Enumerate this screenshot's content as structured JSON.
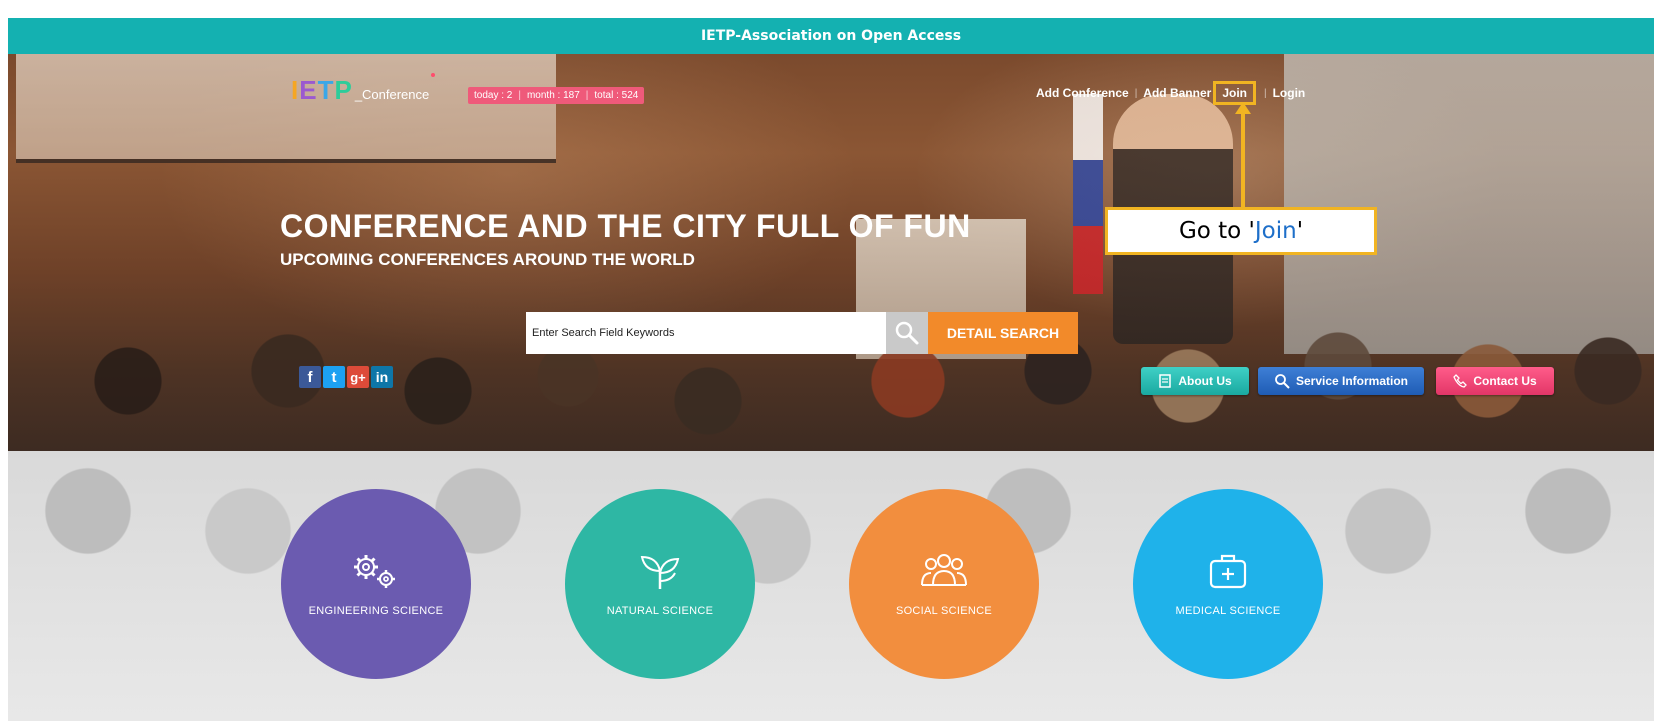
{
  "topbar": {
    "title": "IETP-Association on Open Access"
  },
  "logo": {
    "letters": [
      "I",
      "E",
      "T",
      "P"
    ],
    "suffix": "_Conference"
  },
  "stats": {
    "today": "today : 2",
    "month": "month : 187",
    "total": "total : 524"
  },
  "nav": {
    "add_conference": "Add Conference",
    "add_banner": "Add Banner",
    "join": "Join",
    "login": "Login"
  },
  "callout": {
    "prefix": "Go to '",
    "highlight": "Join",
    "suffix": "'"
  },
  "hero": {
    "headline": "CONFERENCE AND THE CITY FULL OF FUN",
    "subheadline": "UPCOMING CONFERENCES AROUND THE WORLD"
  },
  "search": {
    "placeholder": "Enter Search Field Keywords",
    "detail_label": "DETAIL SEARCH",
    "icon": "search-icon"
  },
  "social": [
    {
      "name": "facebook-icon",
      "glyph": "f"
    },
    {
      "name": "twitter-icon",
      "glyph": "t"
    },
    {
      "name": "google-plus-icon",
      "glyph": "g+"
    },
    {
      "name": "linkedin-icon",
      "glyph": "in"
    }
  ],
  "buttons": {
    "about": "About Us",
    "service": "Service Information",
    "contact": "Contact Us"
  },
  "categories": [
    {
      "label": "ENGINEERING SCIENCE",
      "icon": "gears-icon",
      "color": "#6b5bb0"
    },
    {
      "label": "NATURAL SCIENCE",
      "icon": "leaf-icon",
      "color": "#2eb7a4"
    },
    {
      "label": "SOCIAL SCIENCE",
      "icon": "people-icon",
      "color": "#f28e3e"
    },
    {
      "label": "MEDICAL SCIENCE",
      "icon": "medkit-icon",
      "color": "#1fb2ea"
    }
  ],
  "colors": {
    "teal": "#14b1b1",
    "orange": "#f28a2a",
    "highlight": "#f1b422",
    "pink": "#ef5a7a"
  }
}
